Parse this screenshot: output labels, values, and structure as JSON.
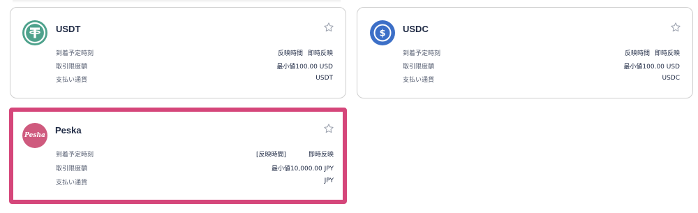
{
  "cards": [
    {
      "name": "USDT",
      "icon": "tether-logo-icon",
      "logo_color": "#4ea28c",
      "rows": [
        {
          "label": "到着予定時刻",
          "value_a": "反映時間",
          "value_b": "即時反映"
        },
        {
          "label": "取引限度額",
          "value": "最小値100.00 USD"
        },
        {
          "label": "支払い通貨",
          "value": "USDT"
        }
      ]
    },
    {
      "name": "USDC",
      "icon": "usdc-logo-icon",
      "logo_color": "#3c6fc7",
      "rows": [
        {
          "label": "到着予定時刻",
          "value_a": "反映時間",
          "value_b": "即時反映"
        },
        {
          "label": "取引限度額",
          "value": "最小値100.00 USD"
        },
        {
          "label": "支払い通貨",
          "value": "USDC"
        }
      ]
    },
    {
      "name": "Peska",
      "icon": "peska-logo-icon",
      "logo_text": "Pesha",
      "logo_color": "#cf5a7e",
      "selected": true,
      "rows": [
        {
          "label": "到着予定時刻",
          "value_a": "[反映時間]",
          "value_b": "即時反映"
        },
        {
          "label": "取引限度額",
          "value": "最小値10,000.00 JPY"
        },
        {
          "label": "支払い通貨",
          "value": "JPY"
        }
      ]
    }
  ],
  "colors": {
    "selected_border": "#d5467a",
    "card_border": "#cfcfcf",
    "text": "#1f2a44"
  }
}
